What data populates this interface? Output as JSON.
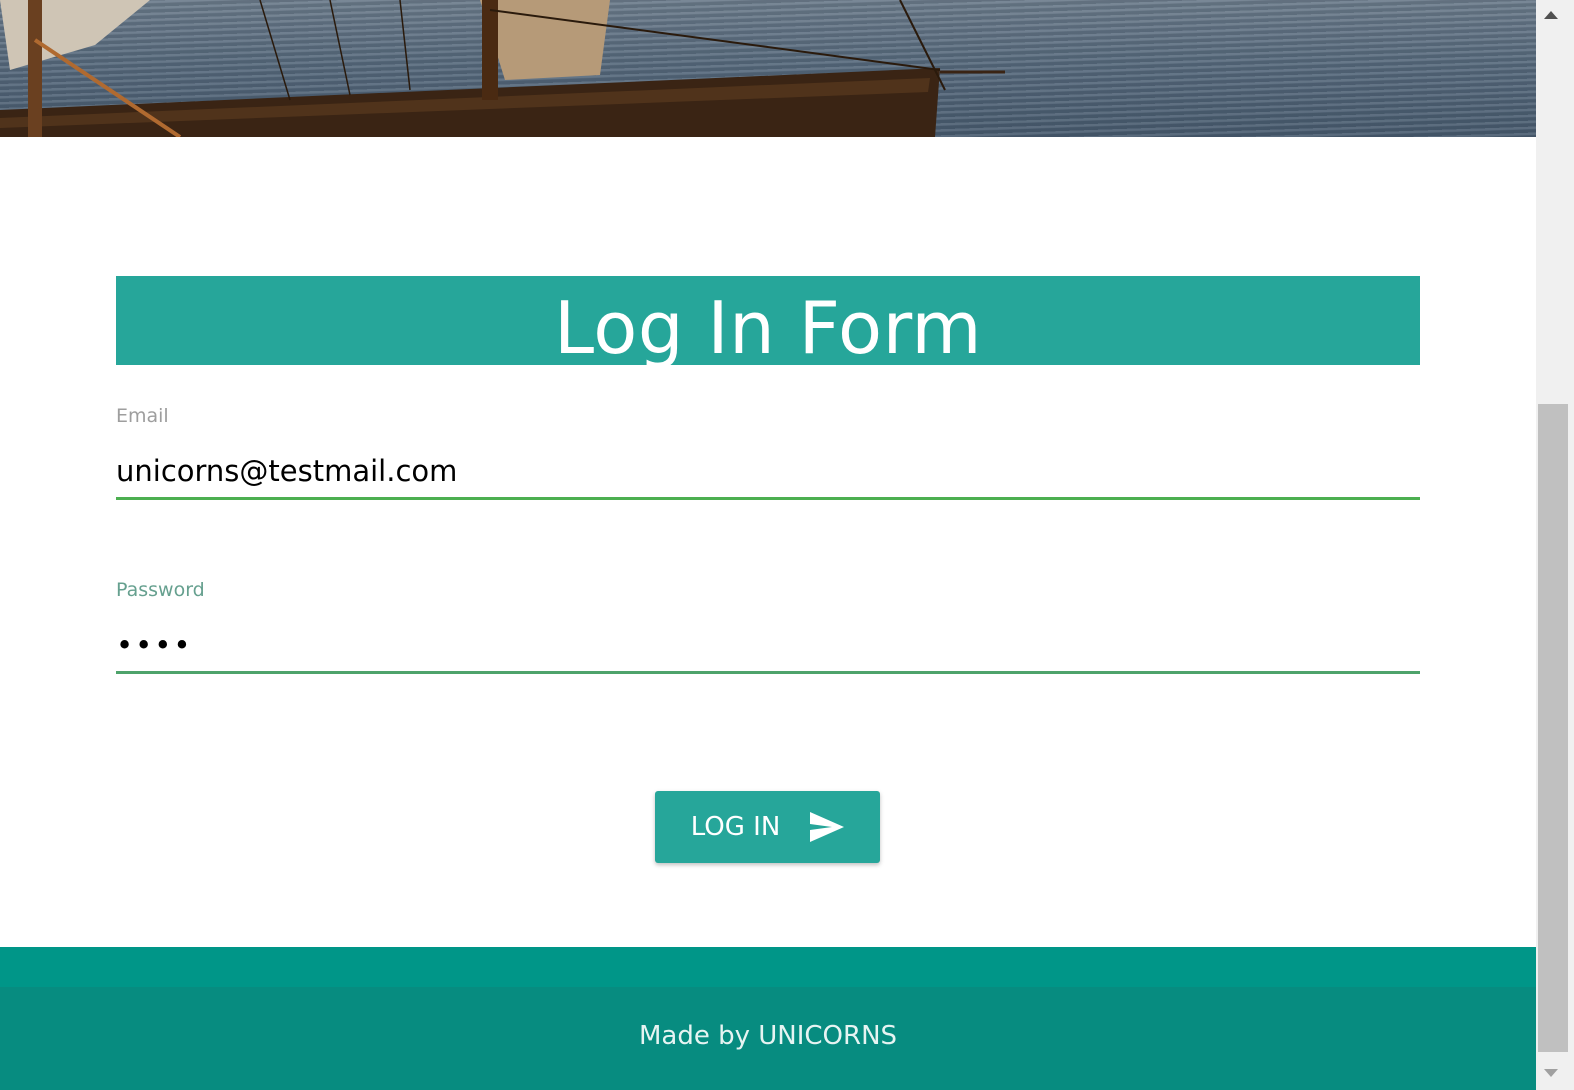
{
  "hero": {
    "image": "ship-on-sea"
  },
  "form": {
    "title": "Log In Form",
    "email": {
      "label": "Email",
      "value": "unicorns@testmail.com"
    },
    "password": {
      "label": "Password",
      "value": "abcd"
    },
    "submit_label": "LOG IN",
    "submit_icon": "send-icon"
  },
  "footer": {
    "text": "Made by UNICORNS"
  },
  "colors": {
    "primary": "#26a69a",
    "footer": "#009688",
    "footer_dark": "#078c80",
    "input_underline": "#4caf50"
  }
}
